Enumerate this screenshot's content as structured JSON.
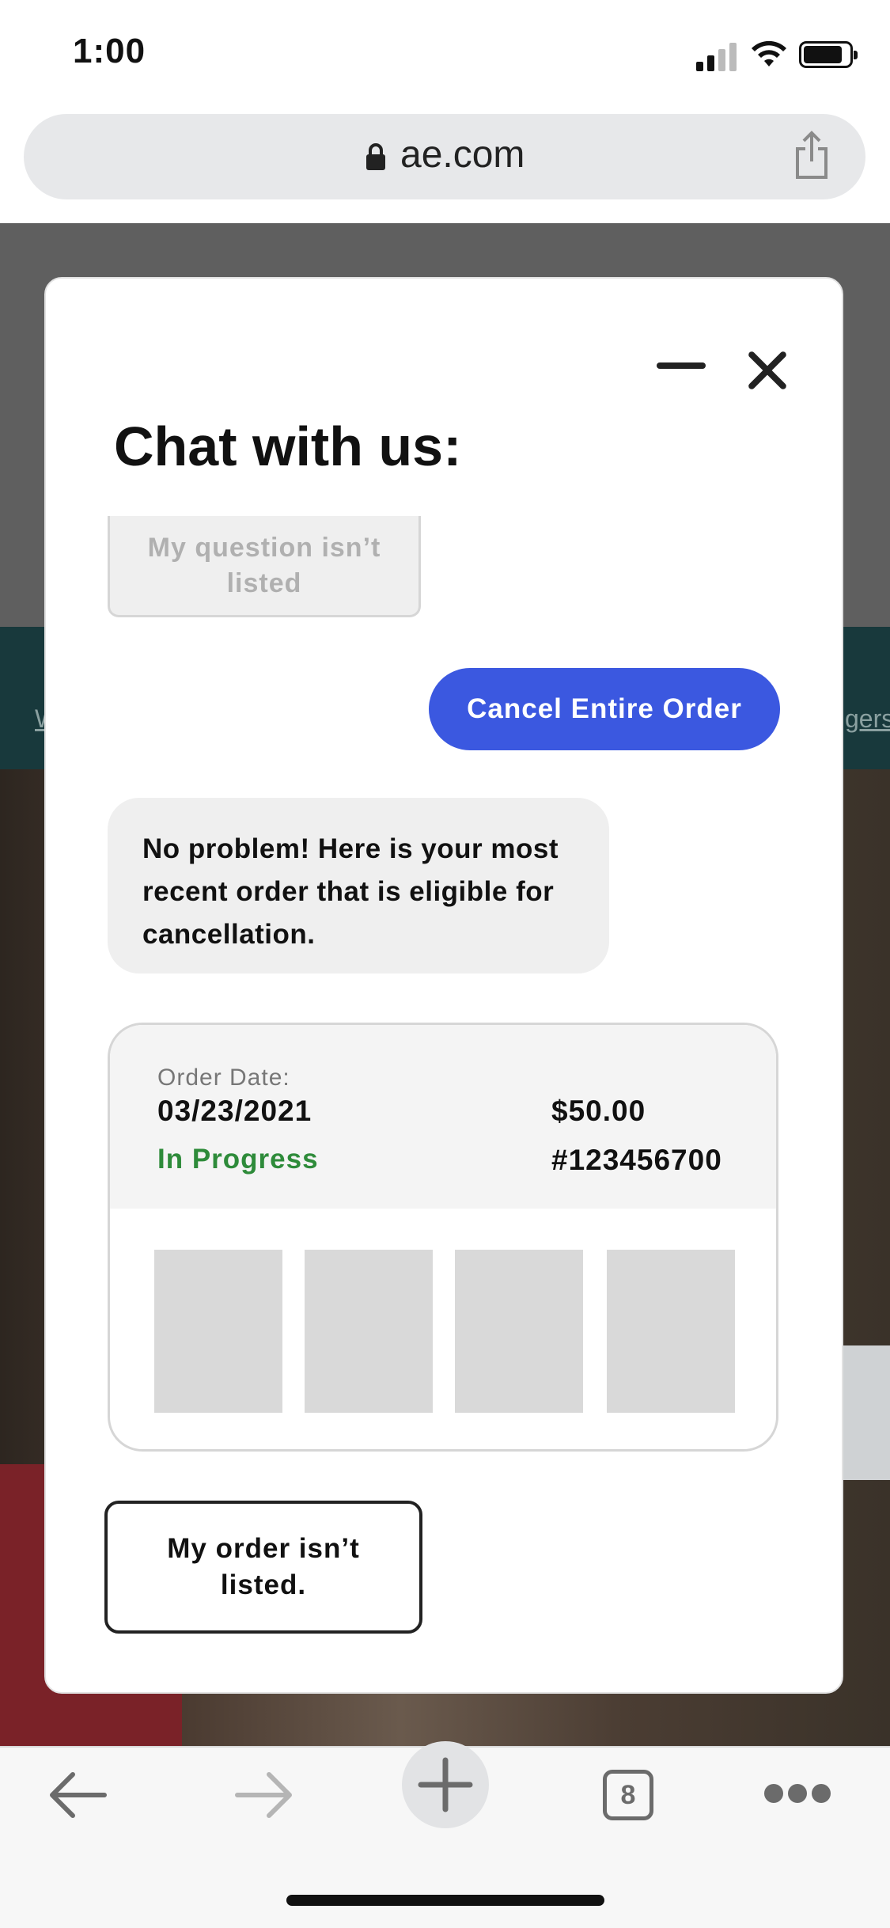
{
  "status_bar": {
    "time": "1:00"
  },
  "browser": {
    "url": "ae.com"
  },
  "background": {
    "teal_left_text": "W",
    "teal_right_text": "gers"
  },
  "chat": {
    "title": "Chat with us:",
    "faded_option": "My question isn’t listed",
    "user_message": "Cancel Entire Order",
    "bot_message": "No problem! Here is your most recent order that is eligible for cancellation.",
    "order": {
      "date_label": "Order Date:",
      "date": "03/23/2021",
      "status": "In Progress",
      "price": "$50.00",
      "order_number": "#123456700",
      "thumbnail_count": 4
    },
    "option_button": "My order isn’t listed."
  },
  "toolbar": {
    "tab_count": "8"
  },
  "colors": {
    "accent": "#3b58e0",
    "status_green": "#2e8b3a",
    "bubble_gray": "#efefef"
  },
  "icons": [
    "lock-icon",
    "share-icon",
    "minimize-icon",
    "close-icon",
    "back-arrow-icon",
    "forward-arrow-icon",
    "plus-icon",
    "tabs-icon",
    "more-icon"
  ]
}
